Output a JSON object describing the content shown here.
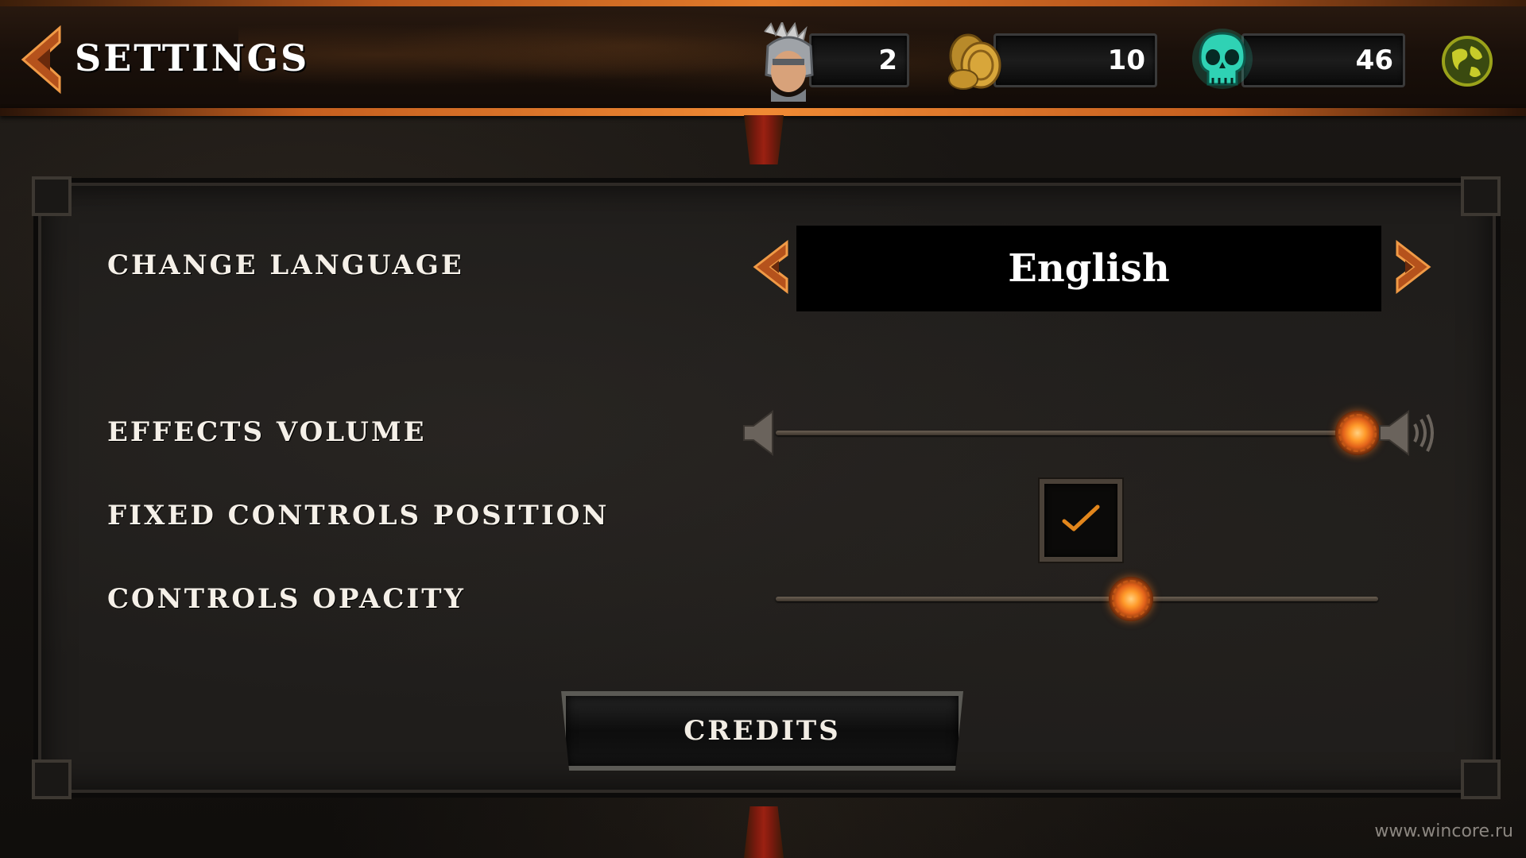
{
  "header": {
    "title": "SETTINGS",
    "resources": [
      {
        "name": "heroes",
        "icon": "knight-helmet-icon",
        "value": "2"
      },
      {
        "name": "gold",
        "icon": "gold-coins-icon",
        "value": "10"
      },
      {
        "name": "souls",
        "icon": "green-skull-icon",
        "value": "46"
      }
    ],
    "globe_icon": "globe-icon"
  },
  "settings": {
    "language": {
      "label": "CHANGE LANGUAGE",
      "value": "English"
    },
    "effects_volume": {
      "label": "EFFECTS VOLUME",
      "level": 0.96
    },
    "fixed_controls": {
      "label": "FIXED CONTROLS POSITION",
      "checked": true
    },
    "controls_opacity": {
      "label": "CONTROLS OPACITY",
      "level": 0.59
    }
  },
  "credits_button": {
    "label": "CREDITS"
  },
  "watermark": "www.wincore.ru",
  "colors": {
    "accent": "#e2621a",
    "frame": "#2e2a26",
    "text": "#f2ede4"
  }
}
